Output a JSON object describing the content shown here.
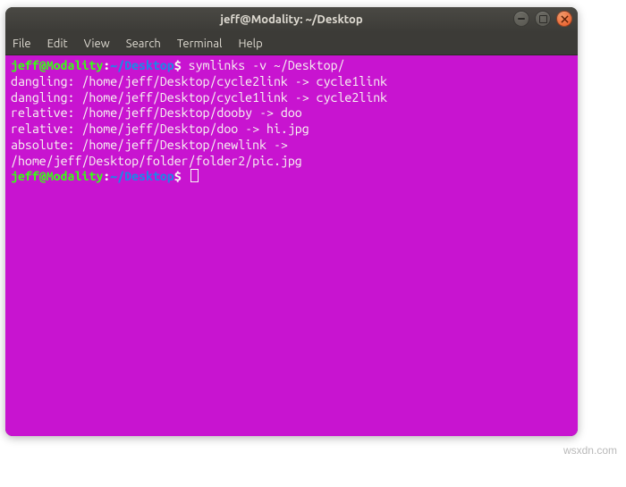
{
  "window": {
    "title": "jeff@Modality: ~/Desktop"
  },
  "menubar": {
    "file": "File",
    "edit": "Edit",
    "view": "View",
    "search": "Search",
    "terminal": "Terminal",
    "help": "Help"
  },
  "prompt": {
    "user_host": "jeff@Modality",
    "sep1": ":",
    "path": "~/Desktop",
    "sep2": "$"
  },
  "terminal": {
    "command": " symlinks -v ~/Desktop/",
    "lines": [
      "dangling: /home/jeff/Desktop/cycle2link -> cycle1link",
      "dangling: /home/jeff/Desktop/cycle1link -> cycle2link",
      "relative: /home/jeff/Desktop/dooby -> doo",
      "relative: /home/jeff/Desktop/doo -> hi.jpg",
      "absolute: /home/jeff/Desktop/newlink -> /home/jeff/Desktop/folder/folder2/pic.jpg"
    ]
  },
  "watermark": "wsxdn.com"
}
